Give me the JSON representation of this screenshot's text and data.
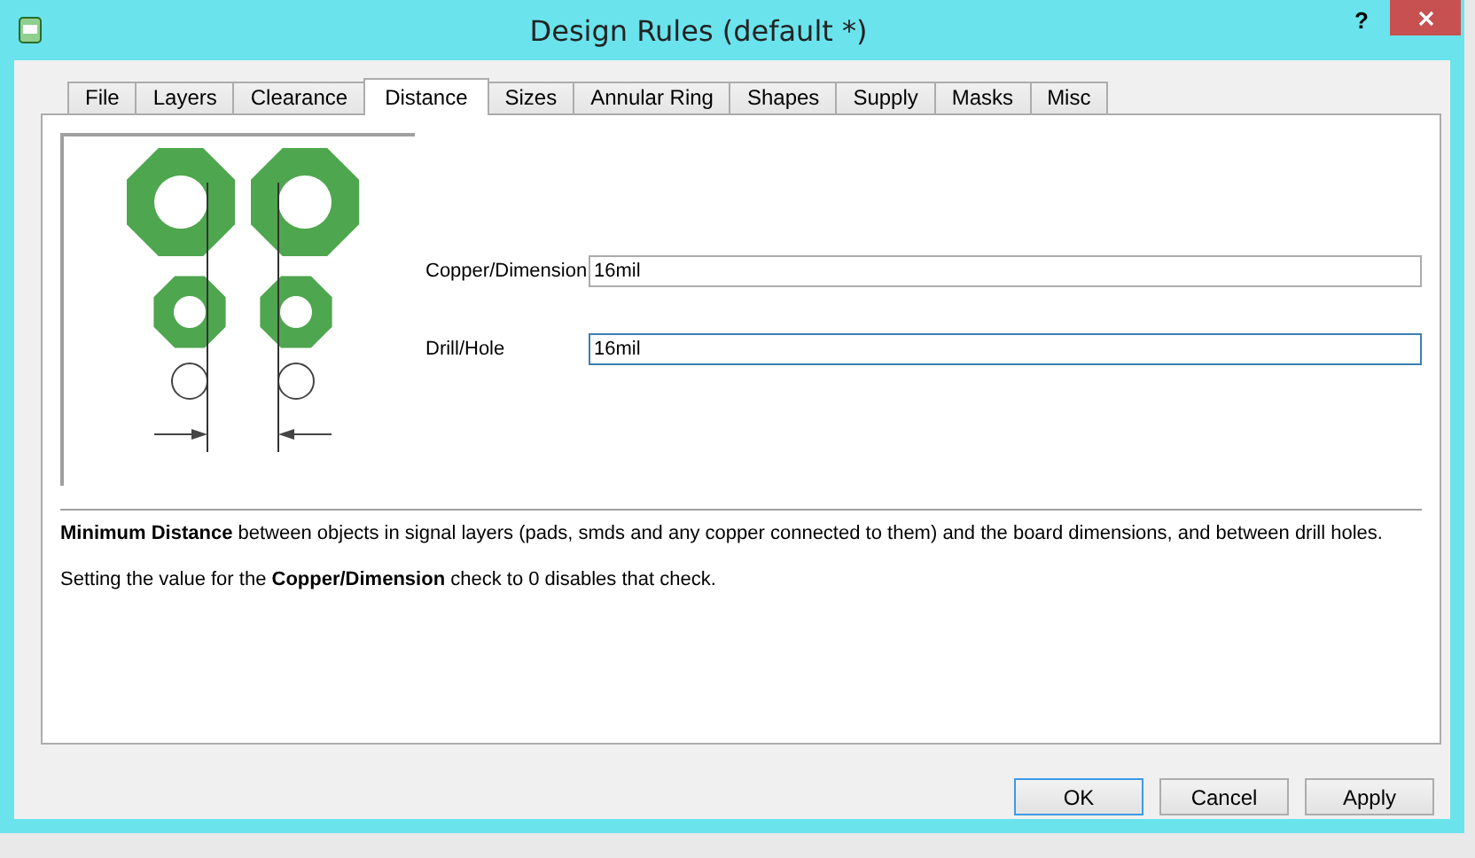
{
  "window": {
    "title": "Design Rules (default *)",
    "help": "?"
  },
  "tabs": [
    {
      "label": "File",
      "selected": false
    },
    {
      "label": "Layers",
      "selected": false
    },
    {
      "label": "Clearance",
      "selected": false
    },
    {
      "label": "Distance",
      "selected": true
    },
    {
      "label": "Sizes",
      "selected": false
    },
    {
      "label": "Annular Ring",
      "selected": false
    },
    {
      "label": "Shapes",
      "selected": false
    },
    {
      "label": "Supply",
      "selected": false
    },
    {
      "label": "Masks",
      "selected": false
    },
    {
      "label": "Misc",
      "selected": false
    }
  ],
  "fields": [
    {
      "label": "Copper/Dimension",
      "value": "16mil",
      "focused": false
    },
    {
      "label": "Drill/Hole",
      "value": "16mil",
      "focused": true
    }
  ],
  "description": [
    "**Minimum Distance** between objects in signal layers (pads, smds and any copper connected to them) and the board dimensions, and between drill holes.",
    "Setting the value for the **Copper/Dimension** check to 0 disables that check."
  ],
  "buttons": [
    {
      "label": "OK",
      "default": true
    },
    {
      "label": "Cancel",
      "default": false
    },
    {
      "label": "Apply",
      "default": false
    }
  ]
}
